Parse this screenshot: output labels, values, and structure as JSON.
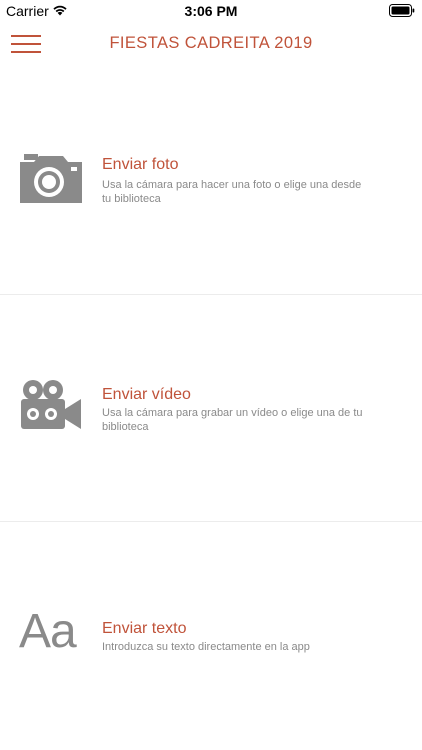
{
  "status_bar": {
    "carrier": "Carrier",
    "time": "3:06 PM"
  },
  "nav": {
    "title": "FIESTAS CADREITA 2019"
  },
  "items": [
    {
      "title": "Enviar foto",
      "description": "Usa la cámara para hacer una foto o elige una desde tu biblioteca",
      "icon": "camera-icon"
    },
    {
      "title": "Enviar vídeo",
      "description": "Usa la cámara para grabar un vídeo o elige una de tu biblioteca",
      "icon": "video-camera-icon"
    },
    {
      "title": "Enviar texto",
      "description": "Introduzca su texto directamente en la app",
      "icon": "text-icon",
      "icon_glyph": "Aa"
    }
  ],
  "colors": {
    "accent": "#c0533a",
    "icon": "#8a8a8a",
    "text_secondary": "#8a8a8a"
  }
}
